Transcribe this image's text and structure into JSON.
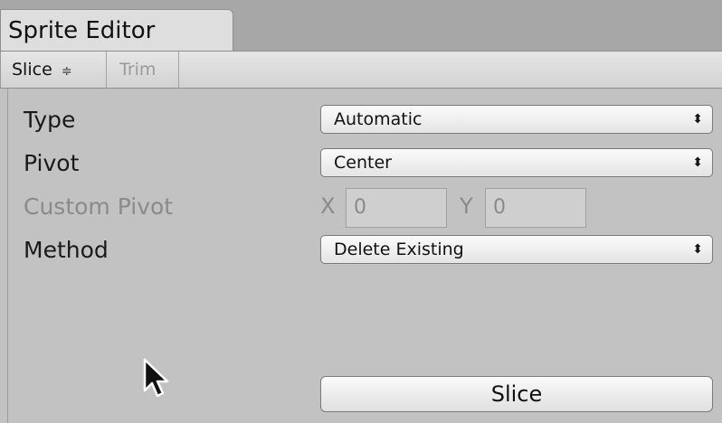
{
  "tab": {
    "title": "Sprite Editor"
  },
  "toolbar": {
    "slice_label": "Slice",
    "slice_arrows": "≑",
    "trim_label": "Trim"
  },
  "form": {
    "type": {
      "label": "Type",
      "value": "Automatic"
    },
    "pivot": {
      "label": "Pivot",
      "value": "Center"
    },
    "custom_pivot": {
      "label": "Custom Pivot",
      "x_label": "X",
      "x_value": "0",
      "y_label": "Y",
      "y_value": "0",
      "enabled": false
    },
    "method": {
      "label": "Method",
      "value": "Delete Existing"
    }
  },
  "dropdown_arrows": "⬍",
  "slice_button": {
    "label": "Slice"
  },
  "colors": {
    "background": "#c2c2c2",
    "tabstrip": "#a7a7a7",
    "disabled_text": "#8a8a8a"
  }
}
